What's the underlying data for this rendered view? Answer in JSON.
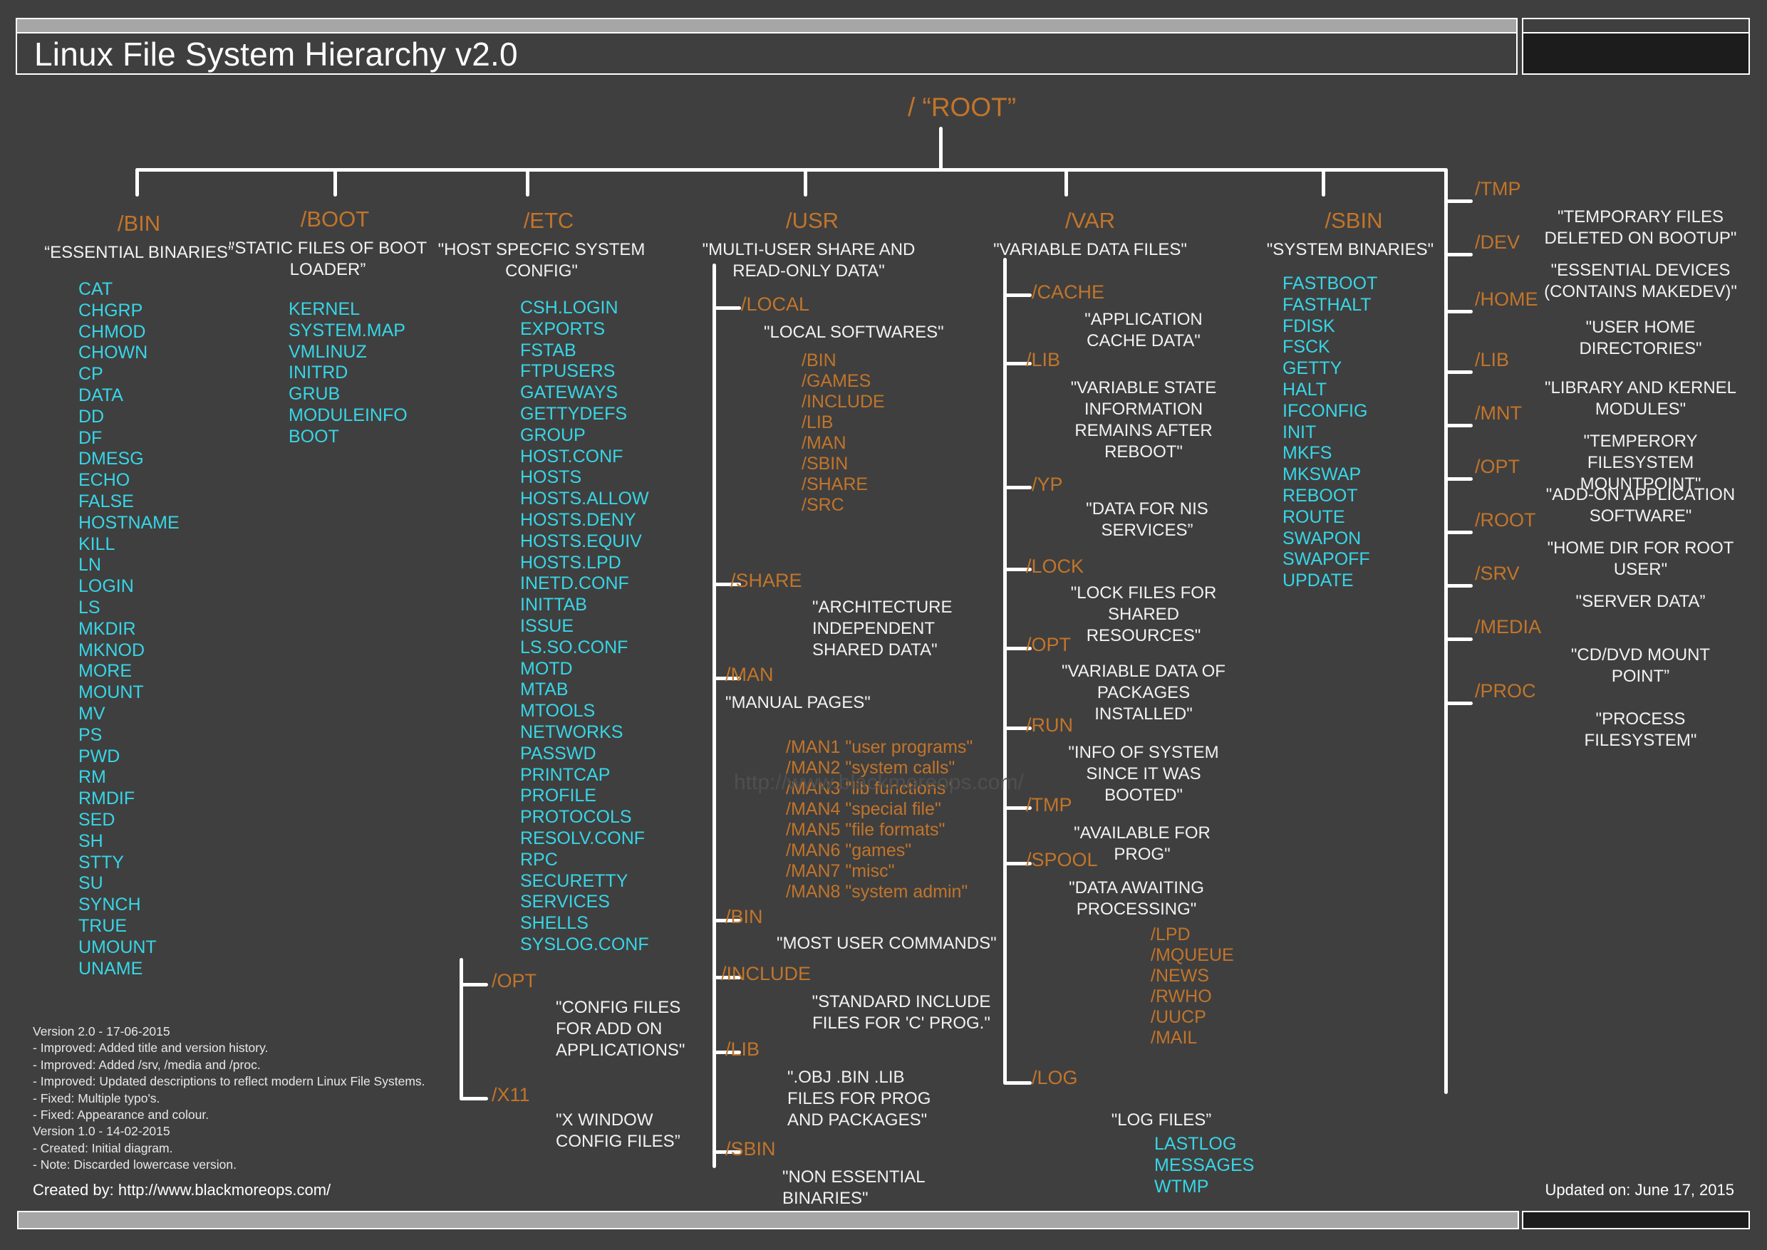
{
  "header": {
    "title": "Linux File System Hierarchy v2.0"
  },
  "footer": {
    "created_by": "Created by: http://www.blackmoreops.com/",
    "updated_on": "Updated on: June 17, 2015"
  },
  "watermark": "http://www.blackmoreops.com/",
  "root": {
    "label": "/ “ROOT”"
  },
  "colors": {
    "background": "#403f3f",
    "directory": "#c1752a",
    "file": "#36d6e7",
    "description": "#f2f2f2",
    "line": "#ffffff",
    "accent_bar": "#a6a6a6"
  },
  "version_notes": "Version 2.0 - 17-06-2015\n- Improved: Added title and version history.\n- Improved: Added /srv, /media and /proc.\n- Improved: Updated descriptions to reflect modern Linux File Systems.\n- Fixed: Multiple typo's.\n- Fixed: Appearance and colour.\nVersion 1.0 - 14-02-2015\n- Created: Initial diagram.\n- Note: Discarded lowercase version.",
  "columns": {
    "bin": {
      "name": "/BIN",
      "desc": "“ESSENTIAL BINARIES”",
      "files": [
        "CAT",
        "CHGRP",
        "CHMOD",
        "CHOWN",
        "CP",
        "DATA",
        "DD",
        "DF",
        "DMESG",
        "ECHO",
        "FALSE",
        "HOSTNAME",
        "KILL",
        "LN",
        "LOGIN",
        "LS",
        "MKDIR",
        "MKNOD",
        "MORE",
        "MOUNT",
        "MV",
        "PS",
        "PWD",
        "RM",
        "RMDIF",
        "SED",
        "SH",
        "STTY",
        "SU",
        "SYNCH",
        "TRUE",
        "UMOUNT",
        "UNAME"
      ]
    },
    "boot": {
      "name": "/BOOT",
      "desc": "\"STATIC FILES OF BOOT LOADER”",
      "files": [
        "KERNEL",
        "SYSTEM.MAP",
        "VMLINUZ",
        "INITRD",
        "GRUB",
        "MODULEINFO",
        "BOOT"
      ]
    },
    "etc": {
      "name": "/ETC",
      "desc": "\"HOST SPECFIC SYSTEM CONFIG\"",
      "files": [
        "CSH.LOGIN",
        "EXPORTS",
        "FSTAB",
        "FTPUSERS",
        "GATEWAYS",
        "GETTYDEFS",
        "GROUP",
        "HOST.CONF",
        "HOSTS",
        "HOSTS.ALLOW",
        "HOSTS.DENY",
        "HOSTS.EQUIV",
        "HOSTS.LPD",
        "INETD.CONF",
        "INITTAB",
        "ISSUE",
        "LS.SO.CONF",
        "MOTD",
        "MTAB",
        "MTOOLS",
        "NETWORKS",
        "PASSWD",
        "PRINTCAP",
        "PROFILE",
        "PROTOCOLS",
        "RESOLV.CONF",
        "RPC",
        "SECURETTY",
        "SERVICES",
        "SHELLS",
        "SYSLOG.CONF"
      ],
      "children": [
        {
          "name": "/OPT",
          "desc": "\"CONFIG FILES FOR ADD ON APPLICATIONS\""
        },
        {
          "name": "/X11",
          "desc": "\"X WINDOW CONFIG FILES”"
        }
      ]
    },
    "usr": {
      "name": "/USR",
      "desc": "\"MULTI-USER SHARE AND READ-ONLY DATA\"",
      "children": [
        {
          "name": "/LOCAL",
          "desc": "\"LOCAL SOFTWARES\"",
          "subdirs": [
            "/BIN",
            "/GAMES",
            "/INCLUDE",
            "/LIB",
            "/MAN",
            "/SBIN",
            "/SHARE",
            "/SRC"
          ]
        },
        {
          "name": "/SHARE",
          "desc": "\"ARCHITECTURE INDEPENDENT SHARED DATA\""
        },
        {
          "name": "/MAN",
          "desc": "\"MANUAL PAGES\"",
          "subdirs": [
            "/MAN1 \"user programs\"",
            "/MAN2 \"system calls\"",
            "/MAN3 \"lib functions\"",
            "/MAN4 \"special file\"",
            "/MAN5 \"file formats\"",
            "/MAN6 \"games\"",
            "/MAN7 \"misc\"",
            "/MAN8 \"system admin\""
          ]
        },
        {
          "name": "/BIN",
          "desc": "\"MOST USER COMMANDS\""
        },
        {
          "name": "/INCLUDE",
          "desc": "\"STANDARD INCLUDE FILES FOR 'C' PROG.\""
        },
        {
          "name": "/LIB",
          "desc": "\".OBJ .BIN .LIB FILES FOR PROG AND PACKAGES\""
        },
        {
          "name": "/SBIN",
          "desc": "\"NON ESSENTIAL BINARIES\""
        }
      ]
    },
    "var": {
      "name": "/VAR",
      "desc": "\"VARIABLE DATA FILES\"",
      "children": [
        {
          "name": "/CACHE",
          "desc": "\"APPLICATION CACHE DATA\""
        },
        {
          "name": "/LIB",
          "desc": "\"VARIABLE STATE INFORMATION REMAINS AFTER REBOOT\""
        },
        {
          "name": "/YP",
          "desc": "\"DATA FOR NIS SERVICES”"
        },
        {
          "name": "/LOCK",
          "desc": "\"LOCK FILES FOR SHARED RESOURCES\""
        },
        {
          "name": "/OPT",
          "desc": "\"VARIABLE DATA OF PACKAGES INSTALLED\""
        },
        {
          "name": "/RUN",
          "desc": "\"INFO OF SYSTEM SINCE IT WAS BOOTED\""
        },
        {
          "name": "/TMP",
          "desc": "\"AVAILABLE FOR PROG\""
        },
        {
          "name": "/SPOOL",
          "desc": "\"DATA AWAITING PROCESSING\"",
          "subdirs": [
            "/LPD",
            "/MQUEUE",
            "/NEWS",
            "/RWHO",
            "/UUCP",
            "/MAIL"
          ]
        },
        {
          "name": "/LOG",
          "desc": "\"LOG FILES”",
          "files": [
            "LASTLOG",
            "MESSAGES",
            "WTMP"
          ]
        }
      ]
    },
    "sbin": {
      "name": "/SBIN",
      "desc": "\"SYSTEM BINARIES\"",
      "files": [
        "FASTBOOT",
        "FASTHALT",
        "FDISK",
        "FSCK",
        "GETTY",
        "HALT",
        "IFCONFIG",
        "INIT",
        "MKFS",
        "MKSWAP",
        "REBOOT",
        "ROUTE",
        "SWAPON",
        "SWAPOFF",
        "UPDATE"
      ]
    },
    "right": {
      "items": [
        {
          "name": "/TMP",
          "desc": "\"TEMPORARY FILES DELETED ON BOOTUP\""
        },
        {
          "name": "/DEV",
          "desc": "\"ESSENTIAL DEVICES (CONTAINS MAKEDEV)\""
        },
        {
          "name": "/HOME",
          "desc": "\"USER HOME DIRECTORIES\""
        },
        {
          "name": "/LIB",
          "desc": "\"LIBRARY AND KERNEL MODULES\""
        },
        {
          "name": "/MNT",
          "desc": "\"TEMPERORY FILESYSTEM MOUNTPOINT\""
        },
        {
          "name": "/OPT",
          "desc": "\"ADD-ON APPLICATION SOFTWARE\""
        },
        {
          "name": "/ROOT",
          "desc": "\"HOME DIR FOR ROOT USER\""
        },
        {
          "name": "/SRV",
          "desc": "\"SERVER DATA”"
        },
        {
          "name": "/MEDIA",
          "desc": "\"CD/DVD MOUNT POINT”"
        },
        {
          "name": "/PROC",
          "desc": "\"PROCESS FILESYSTEM\""
        }
      ]
    }
  }
}
